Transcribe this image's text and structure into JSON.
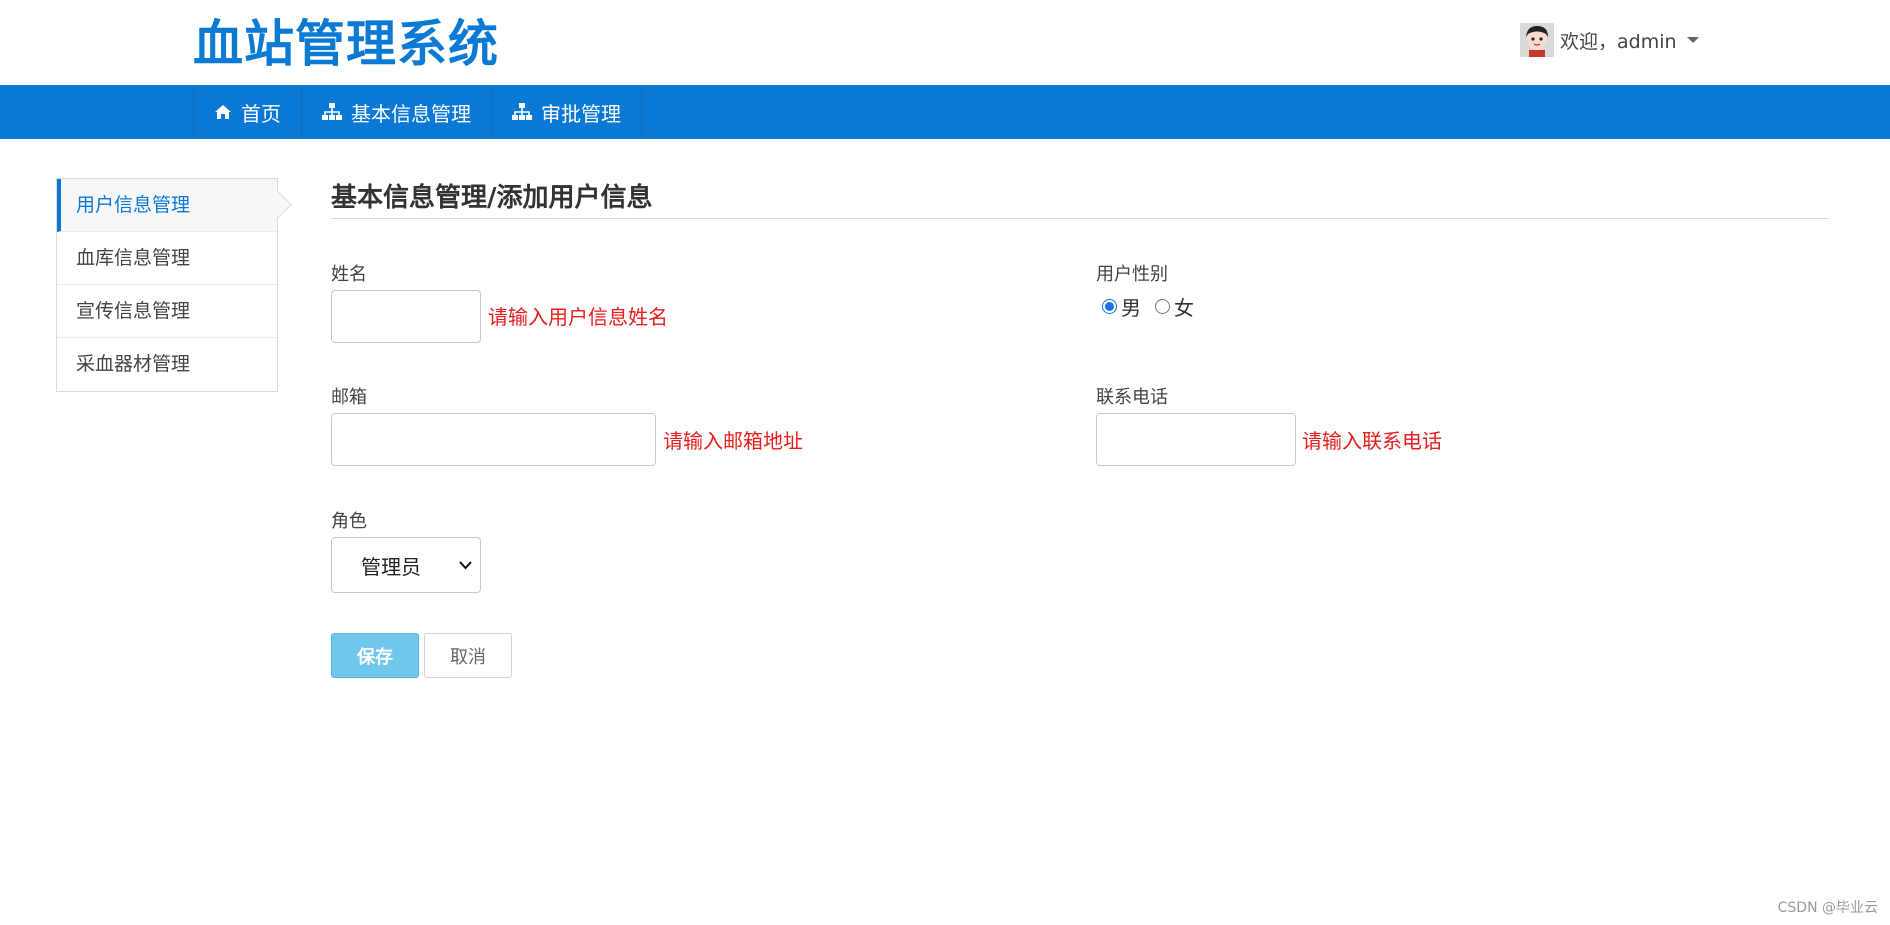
{
  "header": {
    "logo": "血站管理系统",
    "welcome": "欢迎，admin"
  },
  "nav": {
    "items": [
      {
        "label": "首页",
        "icon": "home-icon"
      },
      {
        "label": "基本信息管理",
        "icon": "sitemap-icon"
      },
      {
        "label": "审批管理",
        "icon": "sitemap-icon"
      }
    ]
  },
  "sidebar": {
    "items": [
      {
        "label": "用户信息管理",
        "active": true
      },
      {
        "label": "血库信息管理",
        "active": false
      },
      {
        "label": "宣传信息管理",
        "active": false
      },
      {
        "label": "采血器材管理",
        "active": false
      }
    ]
  },
  "main": {
    "title": "基本信息管理/添加用户信息",
    "form": {
      "name": {
        "label": "姓名",
        "value": "",
        "hint": "请输入用户信息姓名"
      },
      "gender": {
        "label": "用户性别",
        "options": [
          "男",
          "女"
        ],
        "selected": "男"
      },
      "email": {
        "label": "邮箱",
        "value": "",
        "hint": "请输入邮箱地址"
      },
      "phone": {
        "label": "联系电话",
        "value": "",
        "hint": "请输入联系电话"
      },
      "role": {
        "label": "角色",
        "selected": "管理员"
      }
    },
    "buttons": {
      "save": "保存",
      "cancel": "取消"
    }
  },
  "watermark": "CSDN @毕业云",
  "colors": {
    "brand": "#0a79d6",
    "hint": "#e81d1d",
    "save": "#6fc7ec"
  }
}
